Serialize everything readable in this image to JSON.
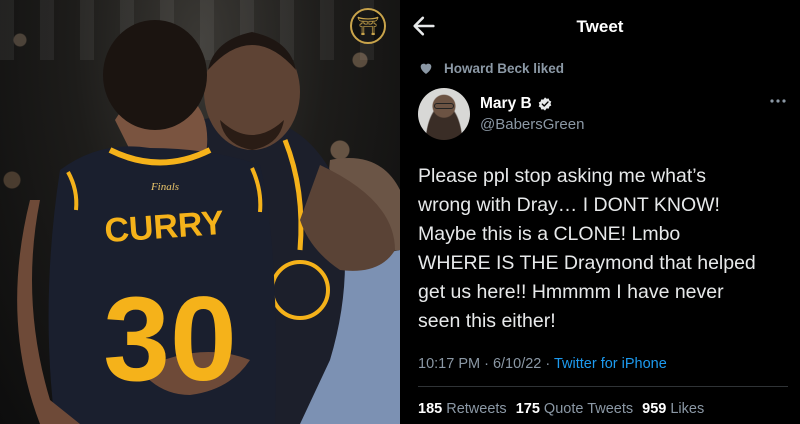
{
  "tweet": {
    "topbar": {
      "title": "Tweet"
    },
    "liked_by": "Howard Beck liked",
    "author": {
      "name": "Mary B",
      "handle": "@BabersGreen"
    },
    "text": "Please ppl stop asking me what’s\nwrong with Dray… I DONT KNOW!\nMaybe this is a CLONE! Lmbo\nWHERE IS THE Draymond that helped\nget us here!! Hmmmm I have never\nseen this either!",
    "meta": {
      "time": "10:17 PM",
      "sep1": " · ",
      "date": "6/10/22",
      "sep2": " · ",
      "source": "Twitter for iPhone"
    },
    "stats": {
      "retweets": {
        "count": "185",
        "label": "Retweets"
      },
      "quotes": {
        "count": "175",
        "label": "Quote Tweets"
      },
      "likes": {
        "count": "959",
        "label": "Likes"
      }
    }
  },
  "photo": {
    "jersey_name": "CURRY",
    "jersey_number": "30",
    "finals_patch": "Finals"
  },
  "colors": {
    "background": "#000000",
    "text_primary": "#e7e9ea",
    "text_secondary": "#8b98a5",
    "link": "#1d9bf0",
    "warriors_navy": "#1a1f2e",
    "warriors_gold": "#f5b21a"
  },
  "icons": [
    "back-arrow-icon",
    "heart-icon",
    "verified-icon",
    "more-horizontal-icon",
    "warriors-logo-icon"
  ]
}
